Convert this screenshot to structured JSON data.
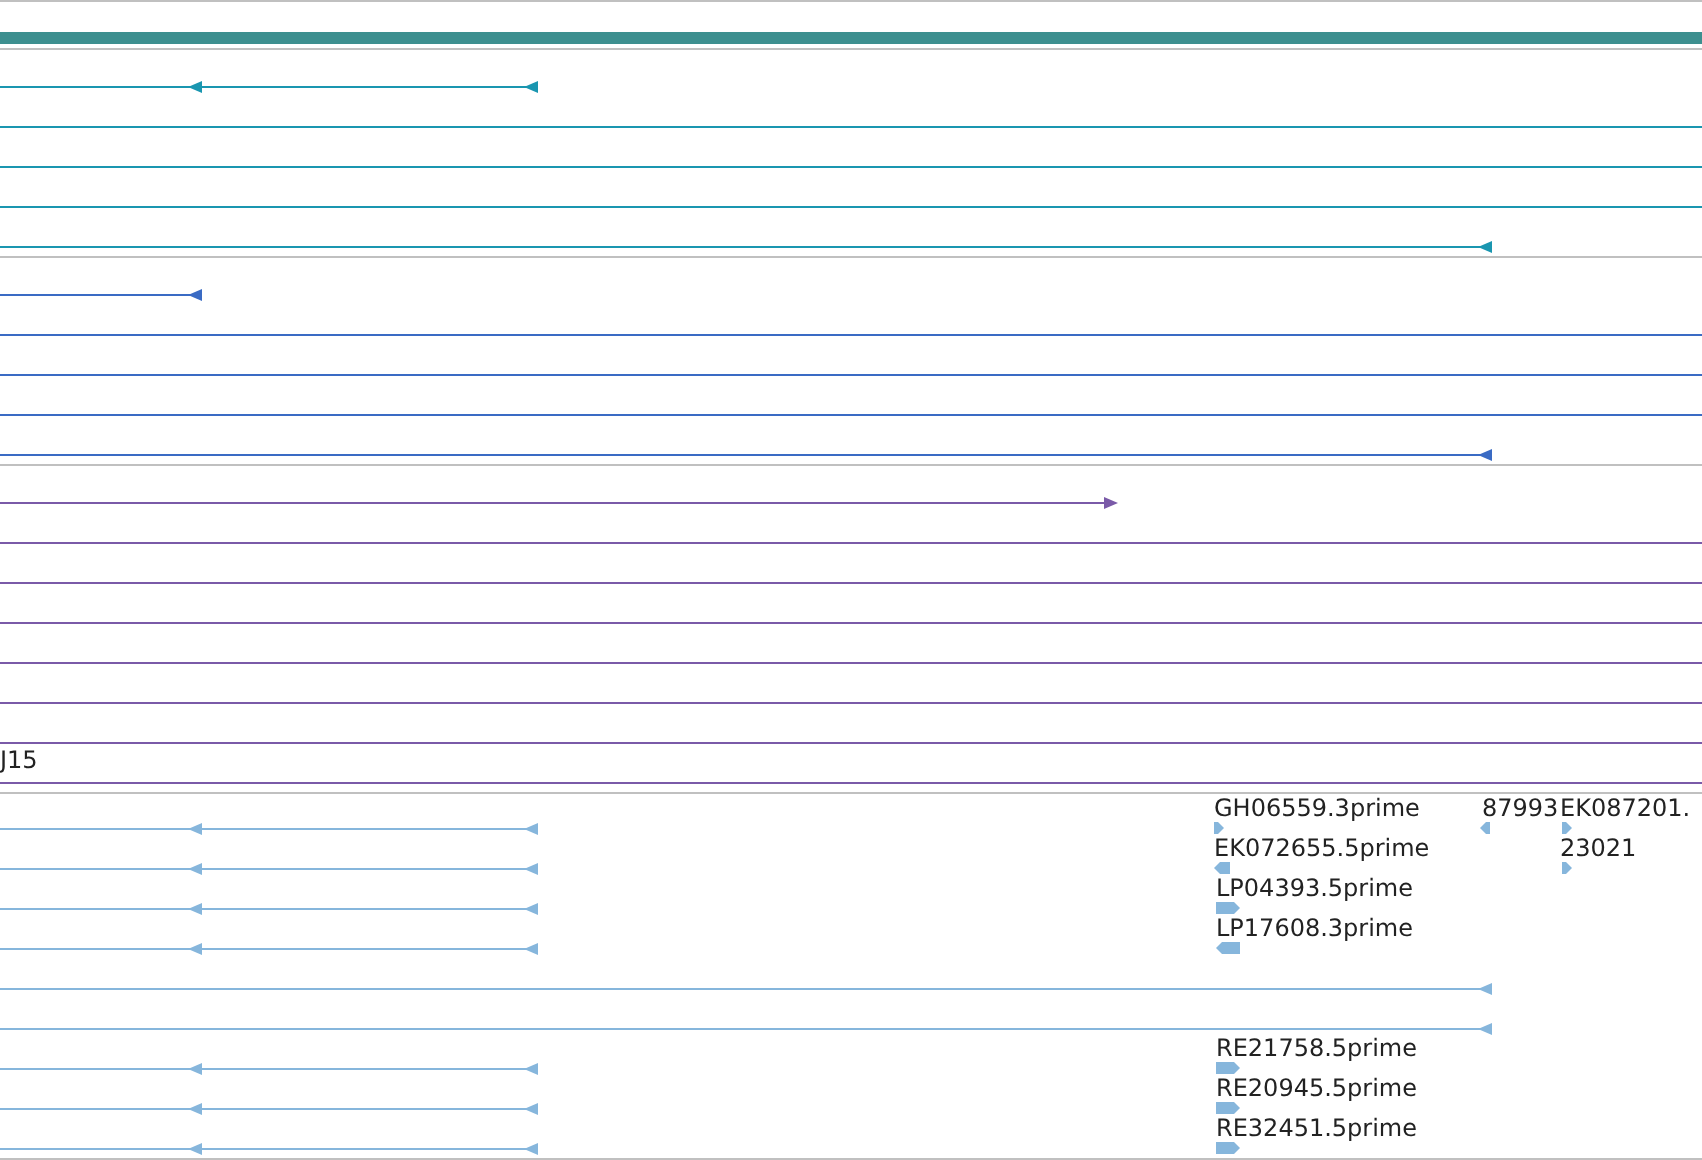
{
  "tracks": [
    {
      "color": "#1a96b0",
      "features": [
        {
          "kind": "bar",
          "color": "#3d8f8f"
        },
        {
          "kind": "transcript",
          "reverse": true
        },
        {
          "kind": "transcript"
        },
        {
          "kind": "transcript"
        },
        {
          "kind": "transcript"
        },
        {
          "kind": "transcript",
          "reverse": true
        }
      ]
    },
    {
      "color": "#3a6bc4",
      "features": [
        {
          "kind": "transcript",
          "reverse": true
        },
        {
          "kind": "transcript"
        },
        {
          "kind": "transcript"
        },
        {
          "kind": "transcript"
        },
        {
          "kind": "transcript",
          "reverse": true
        }
      ]
    },
    {
      "color": "#7a5aa8",
      "features": [
        {
          "kind": "transcript",
          "reverse": false
        },
        {
          "kind": "transcript"
        },
        {
          "kind": "transcript"
        },
        {
          "kind": "transcript"
        },
        {
          "kind": "transcript"
        },
        {
          "kind": "transcript"
        },
        {
          "kind": "transcript"
        },
        {
          "kind": "transcript",
          "label": "J15"
        }
      ]
    },
    {
      "color": "#86b6dc",
      "features": [
        {
          "kind": "transcript",
          "reverse": true
        },
        {
          "kind": "transcript",
          "reverse": true
        },
        {
          "kind": "transcript",
          "reverse": true
        },
        {
          "kind": "transcript",
          "reverse": true
        },
        {
          "kind": "transcript",
          "reverse": true
        },
        {
          "kind": "transcript",
          "reverse": true
        },
        {
          "kind": "transcript",
          "reverse": true
        },
        {
          "kind": "transcript",
          "reverse": true
        },
        {
          "kind": "transcript",
          "reverse": true
        },
        {
          "kind": "read",
          "reverse": false,
          "label": "GH06559.3prime"
        },
        {
          "kind": "read",
          "reverse": true,
          "label": "EK072655.5prime"
        },
        {
          "kind": "read",
          "reverse": false,
          "label": "LP04393.5prime"
        },
        {
          "kind": "read",
          "reverse": true,
          "label": "LP17608.3prime"
        },
        {
          "kind": "read",
          "reverse": true,
          "label": "87993"
        },
        {
          "kind": "read",
          "reverse": false,
          "label": "EK087201."
        },
        {
          "kind": "read",
          "reverse": false,
          "label": "23021"
        },
        {
          "kind": "read",
          "reverse": false,
          "label": "RE21758.5prime"
        },
        {
          "kind": "read",
          "reverse": false,
          "label": "RE20945.5prime"
        },
        {
          "kind": "read",
          "reverse": false,
          "label": "RE32451.5prime"
        }
      ]
    }
  ]
}
